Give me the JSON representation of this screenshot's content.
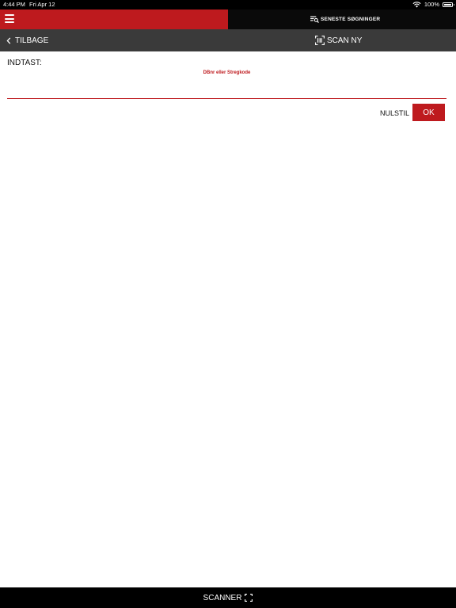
{
  "status_bar": {
    "time": "4:44 PM",
    "date": "Fri Apr 12",
    "battery": "100%",
    "icons": [
      "wifi-icon",
      "battery-icon"
    ]
  },
  "top_bar": {
    "menu_icon": "hamburger-icon",
    "recent_searches_label": "SENESTE SØGNINGER",
    "recent_searches_icon": "list-search-icon",
    "colors": {
      "left": "#be1a1e",
      "right": "#0a0a0a"
    }
  },
  "nav_bar": {
    "back_label": "TILBAGE",
    "back_icon": "chevron-left-icon",
    "scan_new_label": "SCAN NY",
    "scan_new_icon": "barcode-scan-icon",
    "color": "#3a3a3a"
  },
  "form": {
    "label": "INDTAST:",
    "input": {
      "value": "",
      "placeholder": "DBnr eller Stregkode"
    },
    "reset_label": "NULSTIL",
    "ok_label": "OK",
    "accent": "#be1a1e"
  },
  "footer": {
    "scanner_label": "SCANNER",
    "scanner_icon": "scan-frame-icon"
  }
}
